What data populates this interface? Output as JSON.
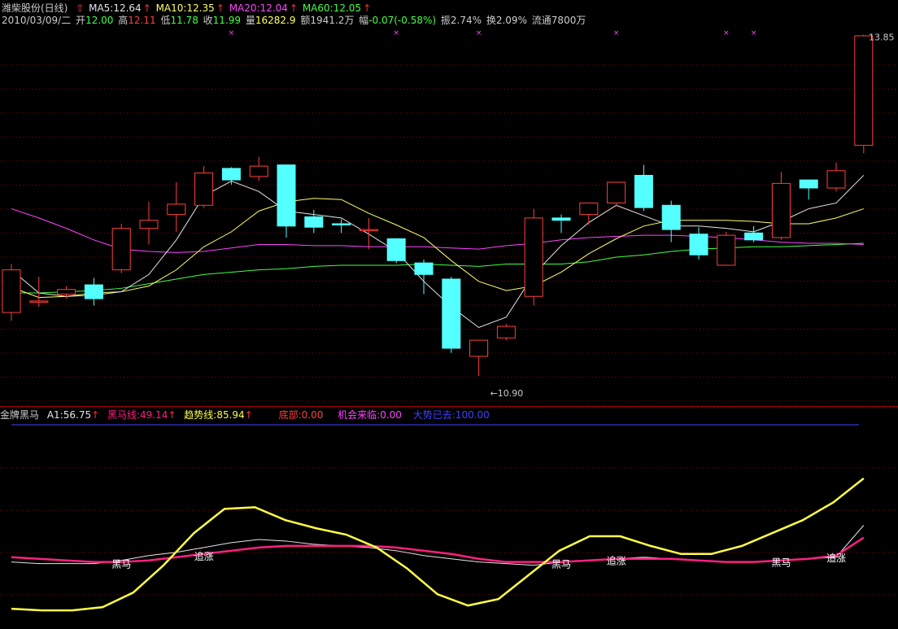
{
  "colors": {
    "up": "#ff3f3f",
    "down": "#54ffff",
    "ma5": "#e6e6e6",
    "ma10": "#ffff66",
    "ma20": "#ff44ff",
    "ma60": "#44ff44",
    "grid": "#880000",
    "heima": "#ff2080",
    "qushi": "#ffff44",
    "cyan_text": "#54ffff",
    "dashi": "#4040ff"
  },
  "header": {
    "stock_name": "潍柴股份(日线)",
    "up_icon": "up-arrow-icon",
    "ma5": "MA5:12.64",
    "ma10": "MA10:12.35",
    "ma20": "MA20:12.04",
    "ma60": "MA60:12.05",
    "date": "2010/03/09/二",
    "open_label": "开",
    "open": "12.00",
    "high_label": "高",
    "high": "12.11",
    "low_label": "低",
    "low": "11.78",
    "close_label": "收",
    "close": "11.99",
    "vol_label": "量",
    "vol": "16282.9",
    "amount_label": "额",
    "amount": "1941.2万",
    "change_label": "幅",
    "change": "-0.07(-0.58%)",
    "amplitude": "振2.74%",
    "turnover": "换2.09%",
    "float": "流通7800万"
  },
  "price_labels": {
    "high": "13.85",
    "low": "←10.90"
  },
  "indicator": {
    "name": "金牌黑马",
    "a1": "A1:56.75",
    "heima": "黑马线:49.14",
    "qushi": "趋势线:85.94",
    "dibu": "底部:0.00",
    "jihui": "机会来临:0.00",
    "dashi": "大势已去:100.00",
    "signals": [
      "黑马",
      "追涨",
      "黑马",
      "追涨",
      "黑马",
      "追涨"
    ]
  },
  "chart_data": {
    "type": "candlestick",
    "price_range": [
      10.9,
      13.85
    ],
    "candles": [
      {
        "o": 11.45,
        "h": 11.87,
        "l": 11.38,
        "c": 11.82
      },
      {
        "o": 11.55,
        "h": 11.76,
        "l": 11.5,
        "c": 11.55
      },
      {
        "o": 11.61,
        "h": 11.68,
        "l": 11.57,
        "c": 11.65
      },
      {
        "o": 11.69,
        "h": 11.75,
        "l": 11.51,
        "c": 11.57
      },
      {
        "o": 11.82,
        "h": 12.22,
        "l": 11.79,
        "c": 12.18
      },
      {
        "o": 12.18,
        "h": 12.41,
        "l": 12.04,
        "c": 12.25
      },
      {
        "o": 12.3,
        "h": 12.58,
        "l": 12.15,
        "c": 12.39
      },
      {
        "o": 12.38,
        "h": 12.72,
        "l": 12.36,
        "c": 12.66
      },
      {
        "o": 12.7,
        "h": 12.71,
        "l": 12.56,
        "c": 12.6
      },
      {
        "o": 12.63,
        "h": 12.8,
        "l": 12.59,
        "c": 12.72
      },
      {
        "o": 12.73,
        "h": 12.73,
        "l": 12.1,
        "c": 12.2
      },
      {
        "o": 12.28,
        "h": 12.34,
        "l": 12.14,
        "c": 12.19
      },
      {
        "o": 12.22,
        "h": 12.26,
        "l": 12.14,
        "c": 12.21
      },
      {
        "o": 12.17,
        "h": 12.27,
        "l": 12.0,
        "c": 12.17
      },
      {
        "o": 12.09,
        "h": 12.09,
        "l": 11.88,
        "c": 11.9
      },
      {
        "o": 11.88,
        "h": 11.91,
        "l": 11.61,
        "c": 11.78
      },
      {
        "o": 11.74,
        "h": 11.76,
        "l": 11.1,
        "c": 11.14
      },
      {
        "o": 11.07,
        "h": 11.2,
        "l": 10.9,
        "c": 11.21
      },
      {
        "o": 11.23,
        "h": 11.35,
        "l": 11.21,
        "c": 11.33
      },
      {
        "o": 11.59,
        "h": 12.35,
        "l": 11.51,
        "c": 12.27
      },
      {
        "o": 12.27,
        "h": 12.3,
        "l": 12.14,
        "c": 12.25
      },
      {
        "o": 12.3,
        "h": 12.4,
        "l": 12.21,
        "c": 12.4
      },
      {
        "o": 12.4,
        "h": 12.58,
        "l": 12.37,
        "c": 12.58
      },
      {
        "o": 12.64,
        "h": 12.73,
        "l": 12.33,
        "c": 12.36
      },
      {
        "o": 12.38,
        "h": 12.42,
        "l": 12.06,
        "c": 12.17
      },
      {
        "o": 12.13,
        "h": 12.19,
        "l": 11.91,
        "c": 11.95
      },
      {
        "o": 11.86,
        "h": 12.15,
        "l": 11.86,
        "c": 12.12
      },
      {
        "o": 12.14,
        "h": 12.2,
        "l": 12.06,
        "c": 12.08
      },
      {
        "o": 12.1,
        "h": 12.67,
        "l": 12.08,
        "c": 12.57
      },
      {
        "o": 12.6,
        "h": 12.6,
        "l": 12.43,
        "c": 12.53
      },
      {
        "o": 12.53,
        "h": 12.75,
        "l": 12.5,
        "c": 12.68
      },
      {
        "o": 12.9,
        "h": 13.86,
        "l": 12.83,
        "c": 13.85
      }
    ],
    "ma5": [
      11.82,
      11.62,
      11.59,
      11.6,
      11.63,
      11.78,
      12.08,
      12.46,
      12.59,
      12.5,
      12.33,
      12.3,
      12.27,
      12.13,
      11.98,
      11.72,
      11.5,
      11.32,
      11.41,
      11.78,
      12.03,
      12.23,
      12.38,
      12.29,
      12.2,
      12.2,
      12.18,
      12.15,
      12.24,
      12.35,
      12.4,
      12.64
    ],
    "ma10": [
      11.67,
      11.58,
      11.59,
      11.62,
      11.63,
      11.68,
      11.82,
      12.02,
      12.15,
      12.33,
      12.41,
      12.44,
      12.43,
      12.31,
      12.21,
      12.1,
      11.9,
      11.72,
      11.64,
      11.68,
      11.8,
      11.96,
      12.09,
      12.2,
      12.25,
      12.25,
      12.25,
      12.24,
      12.22,
      12.22,
      12.27,
      12.35
    ],
    "ma20": [
      12.35,
      12.27,
      12.18,
      12.08,
      12.0,
      11.98,
      11.97,
      11.98,
      12.01,
      12.04,
      12.04,
      12.03,
      12.03,
      12.02,
      12.02,
      12.02,
      12.01,
      12.0,
      12.03,
      12.05,
      12.08,
      12.1,
      12.11,
      12.12,
      12.12,
      12.11,
      12.1,
      12.08,
      12.06,
      12.05,
      12.05,
      12.04
    ],
    "ma60": [
      11.62,
      11.62,
      11.63,
      11.64,
      11.66,
      11.7,
      11.74,
      11.78,
      11.8,
      11.82,
      11.83,
      11.85,
      11.86,
      11.86,
      11.86,
      11.87,
      11.86,
      11.85,
      11.87,
      11.87,
      11.87,
      11.89,
      11.93,
      11.95,
      11.98,
      12.0,
      12.01,
      12.02,
      12.02,
      12.03,
      12.04,
      12.05
    ],
    "ind_range": [
      0,
      100
    ],
    "ind_a1": [
      34,
      33,
      33,
      33,
      35,
      38,
      40,
      43,
      46,
      48,
      47,
      45,
      44,
      43,
      41,
      38,
      36,
      34,
      33,
      32,
      34,
      35,
      36,
      37,
      36,
      35,
      34,
      34,
      35,
      36,
      37,
      56.75
    ],
    "ind_heima": [
      37,
      36,
      35,
      34,
      34,
      35,
      37,
      39,
      41,
      43,
      44,
      44,
      44,
      44,
      43,
      41,
      39,
      36,
      34,
      34,
      34,
      35,
      36,
      36,
      36,
      35,
      34,
      34,
      35,
      36,
      38,
      49.14
    ],
    "ind_qushi": [
      5,
      4,
      4,
      6,
      15,
      32,
      52,
      67,
      68,
      60,
      55,
      51,
      43,
      30,
      14,
      7,
      11,
      26,
      41,
      50,
      50,
      44,
      39,
      39,
      44,
      52,
      60,
      71,
      85.94
    ],
    "ind_qushi_start": 0,
    "high_mark_index": 31,
    "low_mark_index": 17,
    "top_marks": [
      8,
      14,
      17,
      22,
      26,
      27
    ],
    "signal_positions": [
      [
        4,
        "黑马"
      ],
      [
        7,
        "追涨"
      ],
      [
        20,
        "黑马"
      ],
      [
        22,
        "追涨"
      ],
      [
        28,
        "黑马"
      ],
      [
        30,
        "追涨"
      ]
    ]
  }
}
